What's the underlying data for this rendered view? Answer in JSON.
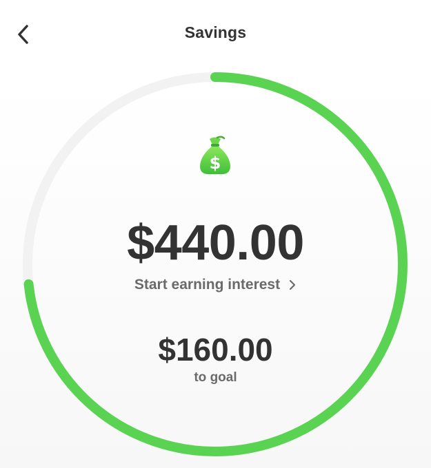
{
  "header": {
    "title": "Savings",
    "back_icon": "chevron-left-icon"
  },
  "savings": {
    "balance": "$440.00",
    "interest_link_label": "Start earning interest",
    "interest_link_icon": "chevron-right-icon",
    "goal_remaining": "$160.00",
    "goal_label": "to goal",
    "progress_fraction": 0.733,
    "bag_icon": "money-bag-icon"
  },
  "colors": {
    "accent_green": "#5ad352",
    "track_gray": "#f2f2f2",
    "text_dark": "#333333",
    "text_muted": "#6a6a6a"
  }
}
